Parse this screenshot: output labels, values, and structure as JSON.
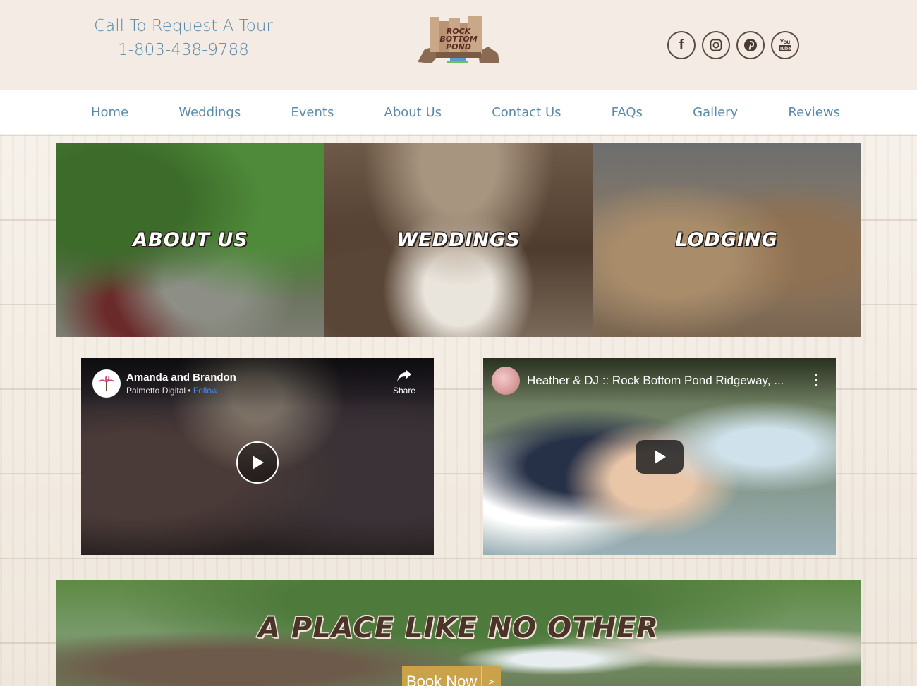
{
  "header": {
    "tour_line": "Call To Request A Tour",
    "phone": "1-803-438-9788",
    "logo_text": [
      "ROCK",
      "BOTTOM",
      "POND"
    ],
    "socials": [
      {
        "name": "facebook",
        "glyph": "f"
      },
      {
        "name": "instagram",
        "glyph": ""
      },
      {
        "name": "pinterest",
        "glyph": ""
      },
      {
        "name": "youtube",
        "glyph": ""
      }
    ]
  },
  "nav": {
    "items": [
      "Home",
      "Weddings",
      "Events",
      "About Us",
      "Contact Us",
      "FAQs",
      "Gallery",
      "Reviews"
    ]
  },
  "tiles": [
    {
      "label": "About Us"
    },
    {
      "label": "Weddings"
    },
    {
      "label": "Lodging"
    }
  ],
  "video_facebook": {
    "title": "Amanda and Brandon",
    "channel": "Palmetto Digital",
    "separator": " • ",
    "follow": "Follow",
    "share": "Share"
  },
  "video_youtube": {
    "title": "Heather & DJ :: Rock Bottom Pond Ridgeway, ...",
    "menu": "⋮"
  },
  "banner": {
    "title": "A Place Like No Other",
    "book_label": "Book Now",
    "book_arrow": ">"
  },
  "colors": {
    "link_blue": "#5b8aa9",
    "header_bg": "#f4ece4",
    "button_gold": "#c9a24a",
    "title_brown": "#4a3328"
  }
}
